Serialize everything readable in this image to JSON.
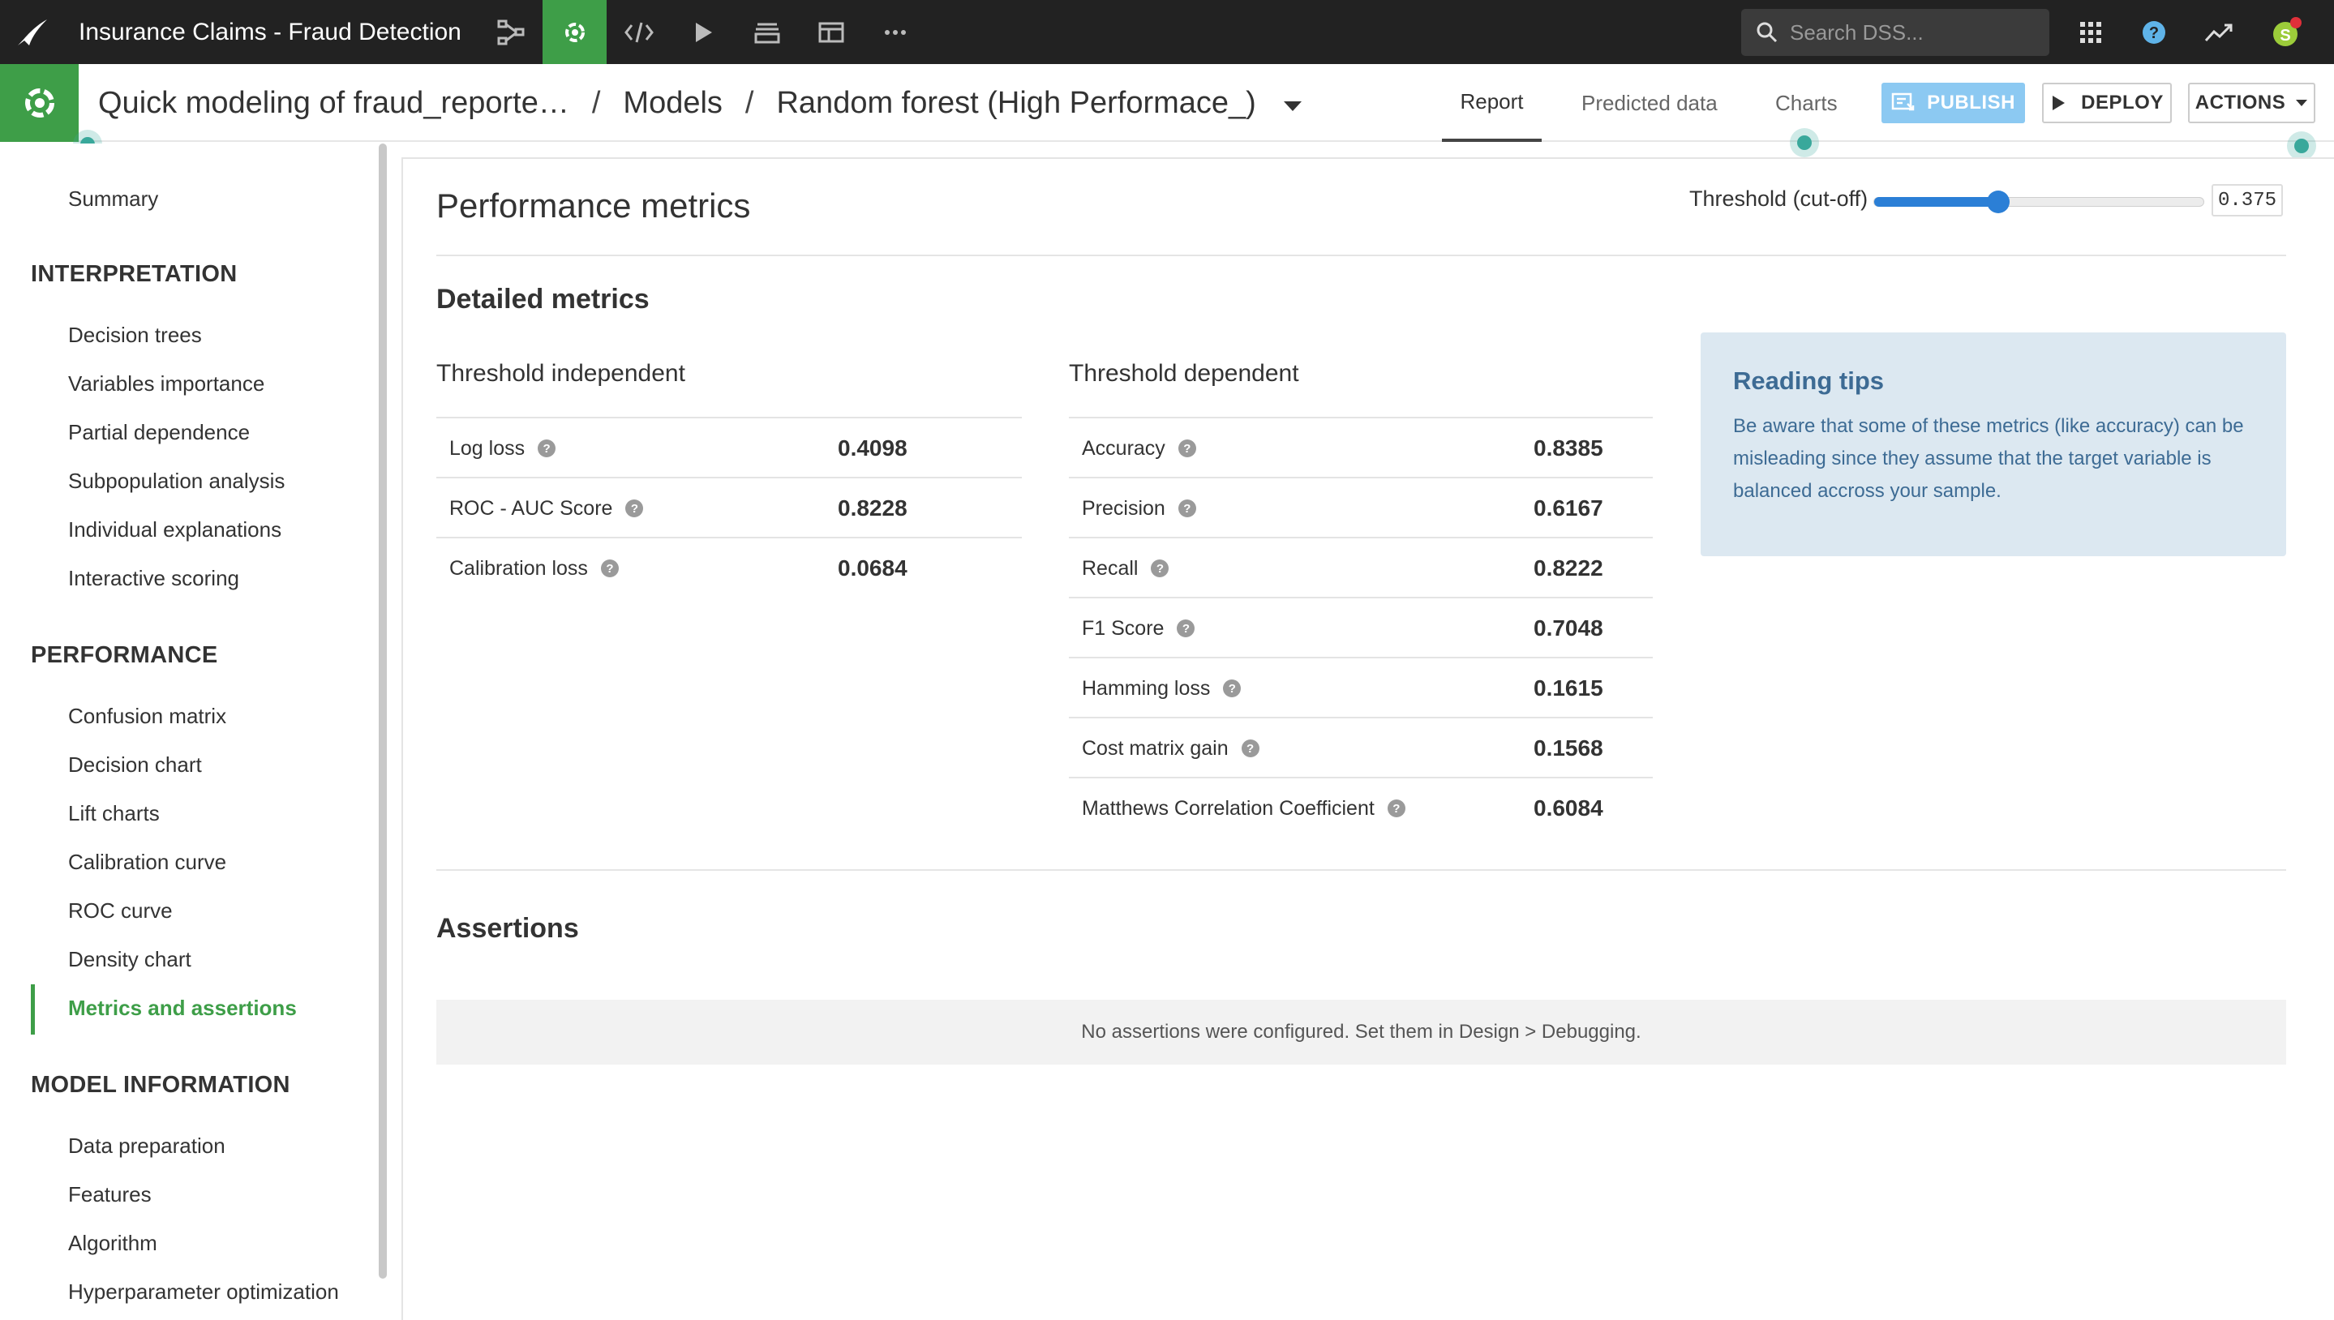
{
  "topnav": {
    "project_title": "Insurance Claims - Fraud Detection",
    "search_placeholder": "Search DSS...",
    "avatar_letter": "S"
  },
  "subheader": {
    "analysis_name": "Quick modeling of fraud_reporte…",
    "sep1": "/",
    "models": "Models",
    "sep2": "/",
    "model_name": "Random forest (High Performace_)",
    "tabs": [
      "Report",
      "Predicted data",
      "Charts"
    ],
    "publish": "PUBLISH",
    "deploy": "DEPLOY",
    "actions": "ACTIONS"
  },
  "sidebar": {
    "summary": "Summary",
    "interpretation_heading": "INTERPRETATION",
    "interpretation": [
      "Decision trees",
      "Variables importance",
      "Partial dependence",
      "Subpopulation analysis",
      "Individual explanations",
      "Interactive scoring"
    ],
    "performance_heading": "PERFORMANCE",
    "performance": [
      "Confusion matrix",
      "Decision chart",
      "Lift charts",
      "Calibration curve",
      "ROC curve",
      "Density chart",
      "Metrics and assertions"
    ],
    "model_info_heading": "MODEL INFORMATION",
    "model_info": [
      "Data preparation",
      "Features",
      "Algorithm",
      "Hyperparameter optimization"
    ]
  },
  "main": {
    "title": "Performance metrics",
    "threshold_label": "Threshold (cut-off)",
    "threshold_value": "0.375",
    "threshold_fraction": 0.375,
    "detailed_heading": "Detailed metrics",
    "independent": {
      "heading": "Threshold independent",
      "rows": [
        {
          "label": "Log loss",
          "value": "0.4098"
        },
        {
          "label": "ROC - AUC Score",
          "value": "0.8228"
        },
        {
          "label": "Calibration loss",
          "value": "0.0684"
        }
      ]
    },
    "dependent": {
      "heading": "Threshold dependent",
      "rows": [
        {
          "label": "Accuracy",
          "value": "0.8385"
        },
        {
          "label": "Precision",
          "value": "0.6167"
        },
        {
          "label": "Recall",
          "value": "0.8222"
        },
        {
          "label": "F1 Score",
          "value": "0.7048"
        },
        {
          "label": "Hamming loss",
          "value": "0.1615"
        },
        {
          "label": "Cost matrix gain",
          "value": "0.1568"
        },
        {
          "label": "Matthews Correlation Coefficient",
          "value": "0.6084"
        }
      ]
    },
    "tips": {
      "title": "Reading tips",
      "body": "Be aware that some of these metrics (like accuracy) can be misleading since they assume that the target variable is balanced accross your sample."
    },
    "assertions_heading": "Assertions",
    "assertions_empty": "No assertions were configured. Set them in Design > Debugging."
  },
  "colors": {
    "accent_green": "#3e9e48",
    "slider_blue": "#2b7fd6",
    "publish_blue": "#8cc9f2",
    "tips_bg": "#dce8f1",
    "topbar": "#222222"
  }
}
